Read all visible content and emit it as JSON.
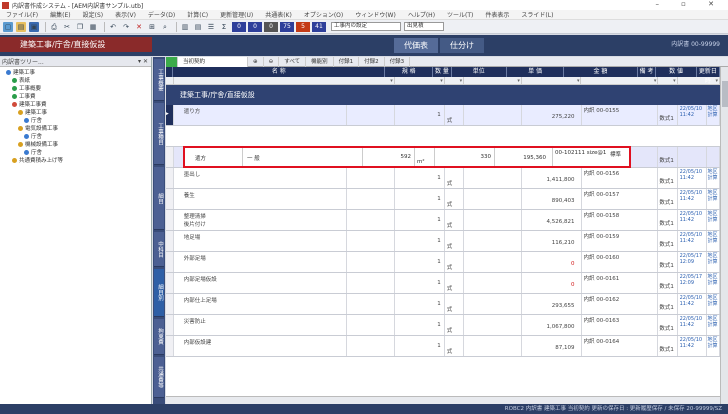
{
  "window": {
    "title": "内訳書作成システム - [AEM内訳書サンプル.utb]",
    "controls": "– ▫ ✕"
  },
  "menubar": [
    "ファイル(F)",
    "編集(E)",
    "設定(S)",
    "表示(V)",
    "データ(D)",
    "計算(C)",
    "更新管理(U)",
    "共通表(K)",
    "オプション(O)",
    "ウィンドウ(W)",
    "ヘルプ(H)",
    "ツール(T)",
    "件表表示",
    "スライド(L)"
  ],
  "toolbar": {
    "counts": [
      "0",
      "0",
      "0",
      "75",
      "5",
      "41"
    ],
    "count_colors": [
      "#2e3f9a",
      "#2e3f9a",
      "#555555",
      "#2e3f9a",
      "#c43b16",
      "#2e3f9a"
    ],
    "field1": "工事内の設定",
    "field2": "出見積"
  },
  "header": {
    "path": "建築工事/庁舎/直接仮設",
    "tabs": [
      "代価表",
      "仕分け"
    ],
    "doc_id": "内訳書 00-99999"
  },
  "tree": {
    "title": "内訳書ツリー...",
    "pin": "▾ ✕",
    "items": [
      {
        "label": "建築工事",
        "indent": 1,
        "color": "#3a7ad0"
      },
      {
        "label": "表紙",
        "indent": 2,
        "color": "#2a9d4a"
      },
      {
        "label": "工事概要",
        "indent": 2,
        "color": "#2a9d4a"
      },
      {
        "label": "工事費",
        "indent": 2,
        "color": "#2a9d4a"
      },
      {
        "label": "建築工事費",
        "indent": 2,
        "color": "#d04a3a"
      },
      {
        "label": "建築工事",
        "indent": 3,
        "color": "#d8a020"
      },
      {
        "label": "庁舎",
        "indent": 4,
        "color": "#3a7ad0"
      },
      {
        "label": "電気設備工事",
        "indent": 3,
        "color": "#d8a020"
      },
      {
        "label": "庁舎",
        "indent": 4,
        "color": "#3a7ad0"
      },
      {
        "label": "機械設備工事",
        "indent": 3,
        "color": "#d8a020"
      },
      {
        "label": "庁舎",
        "indent": 4,
        "color": "#3a7ad0"
      },
      {
        "label": "共通費積み上げ等",
        "indent": 2,
        "color": "#d8a020"
      }
    ]
  },
  "vtabs": [
    "工事概要",
    "工事種目",
    "細目",
    "中科目",
    "細目別",
    "拘束費",
    "共通費等"
  ],
  "grid_toolbar": {
    "category": "当初契約",
    "buttons": [
      "すべて",
      "機能別",
      "付録1",
      "付録2",
      "付録3"
    ]
  },
  "columns": [
    "名 称",
    "規 格",
    "数 量",
    "単位",
    "単 価",
    "金 額",
    "備 考",
    "数 値",
    "更新日時"
  ],
  "section_title": "建築工事/庁舎/直接仮設",
  "rows": [
    {
      "name": "遣り方",
      "spec": "",
      "qty": "1",
      "unit": "式",
      "price": "",
      "amount": "275,220",
      "note": "内訳 00-0155",
      "flag": "数式1",
      "date": "22/05/10\n11:42",
      "badge": "地区\n計算"
    },
    {
      "name": "遣方",
      "spec": "一 般",
      "qty": "592",
      "unit": "m²",
      "price": "330",
      "amount": "195,360",
      "note": "00-102111 size@1",
      "note2": "標準",
      "flag": "",
      "date": "",
      "badge": "",
      "selected": true
    },
    {
      "name": "（計:6%個行）",
      "spec": "",
      "qty": "",
      "unit": "",
      "price": "",
      "amount": "275,220",
      "note": "",
      "flag": "数式1",
      "date": "",
      "badge": "",
      "sub": true
    },
    {
      "name": "墨出し",
      "spec": "",
      "qty": "1",
      "unit": "式",
      "price": "",
      "amount": "1,411,800",
      "note": "内訳 00-0156",
      "flag": "数式1",
      "date": "22/05/10\n11:42",
      "badge": "地区\n計算"
    },
    {
      "name": "養生",
      "spec": "",
      "qty": "1",
      "unit": "式",
      "price": "",
      "amount": "890,403",
      "note": "内訳 00-0157",
      "flag": "数式1",
      "date": "22/05/10\n11:42",
      "badge": "地区\n計算"
    },
    {
      "name": "整理清掃\n後片付け",
      "spec": "",
      "qty": "1",
      "unit": "式",
      "price": "",
      "amount": "4,526,821",
      "note": "内訳 00-0158",
      "flag": "数式1",
      "date": "22/05/10\n11:42",
      "badge": "地区\n計算"
    },
    {
      "name": "地足場",
      "spec": "",
      "qty": "1",
      "unit": "式",
      "price": "",
      "amount": "116,210",
      "note": "内訳 00-0159",
      "flag": "数式1",
      "date": "22/05/10\n11:42",
      "badge": "地区\n計算"
    },
    {
      "name": "外部足場",
      "spec": "",
      "qty": "1",
      "unit": "式",
      "price": "",
      "amount": "0",
      "note": "内訳 00-0160",
      "flag": "数式1",
      "date": "22/05/17\n12:09",
      "badge": "地区\n計算",
      "red": true
    },
    {
      "name": "内部足場仮設",
      "spec": "",
      "qty": "1",
      "unit": "式",
      "price": "",
      "amount": "0",
      "note": "内訳 00-0161",
      "flag": "数式1",
      "date": "22/05/17\n12:09",
      "badge": "地区\n計算",
      "red": true
    },
    {
      "name": "内部仕上足場",
      "spec": "",
      "qty": "1",
      "unit": "式",
      "price": "",
      "amount": "293,655",
      "note": "内訳 00-0162",
      "flag": "数式1",
      "date": "22/05/10\n11:42",
      "badge": "地区\n計算"
    },
    {
      "name": "災害防止",
      "spec": "",
      "qty": "1",
      "unit": "式",
      "price": "",
      "amount": "1,067,800",
      "note": "内訳 00-0163",
      "flag": "数式1",
      "date": "22/05/10\n11:42",
      "badge": "地区\n計算"
    },
    {
      "name": "内部仮設建",
      "spec": "",
      "qty": "1",
      "unit": "式",
      "price": "",
      "amount": "87,109",
      "note": "内訳 00-0164",
      "flag": "数式1",
      "date": "22/05/10\n11:42",
      "badge": "地区\n計算"
    }
  ],
  "status": "ROBC2 内訳書 建築工事 当初契約 更新の保存日 : 更新履歴保存 / 未保存 20-99999/SZ"
}
